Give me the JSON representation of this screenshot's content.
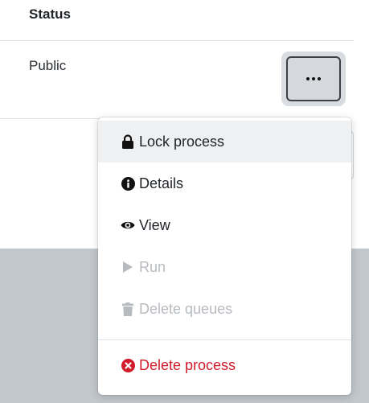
{
  "table": {
    "header": "Status",
    "rows": [
      {
        "status": "Public"
      }
    ]
  },
  "actions_button": {
    "icon": "ellipsis-icon"
  },
  "menu": {
    "items": [
      {
        "label": "Lock process",
        "icon": "lock-icon",
        "state": "hovered"
      },
      {
        "label": "Details",
        "icon": "info-circle-icon",
        "state": "enabled"
      },
      {
        "label": "View",
        "icon": "eye-icon",
        "state": "enabled"
      },
      {
        "label": "Run",
        "icon": "play-icon",
        "state": "disabled"
      },
      {
        "label": "Delete queues",
        "icon": "trash-icon",
        "state": "disabled"
      },
      {
        "label": "Delete process",
        "icon": "times-circle-icon",
        "state": "danger"
      }
    ]
  },
  "colors": {
    "danger": "#d11a2a",
    "disabled_text": "#b7bbbf",
    "backdrop": "#c2c7cc",
    "hover_bg": "#eef0f2"
  }
}
